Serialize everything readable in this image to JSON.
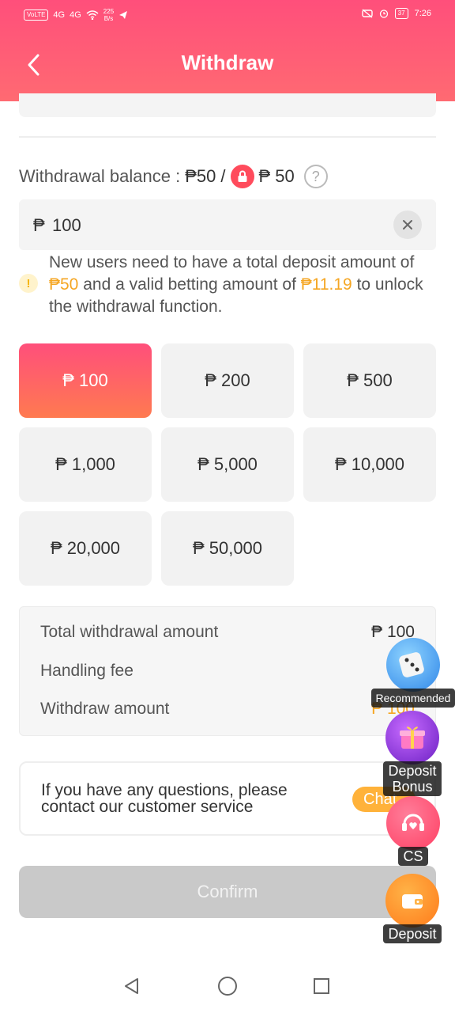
{
  "status_bar": {
    "left_chip": "VoLTE",
    "left_signal_1": "4G",
    "left_signal_2": "4G",
    "speed": "225",
    "speed_unit": "B/s",
    "time": "7:26",
    "battery": "37"
  },
  "header": {
    "title": "Withdraw"
  },
  "balance": {
    "label": "Withdrawal balance : ",
    "available": "₱50",
    "separator": " / ",
    "locked": "₱ 50"
  },
  "amount_input": {
    "currency": "₱",
    "value": "100"
  },
  "notice": {
    "part1": "New users need to have a total deposit amount of ",
    "deposit_amount": "₱50",
    "part2": " and a valid betting amount of ",
    "betting_amount": "₱11.19",
    "part3": " to unlock the withdrawal function."
  },
  "amount_options": [
    "₱ 100",
    "₱ 200",
    "₱ 500",
    "₱ 1,000",
    "₱ 5,000",
    "₱ 10,000",
    "₱ 20,000",
    "₱ 50,000"
  ],
  "selected_option": "₱ 100",
  "summary": {
    "total_label": "Total withdrawal amount",
    "total_value": "₱ 100",
    "fee_label": "Handling fee",
    "withdraw_label": "Withdraw amount",
    "withdraw_value": "₱ 100"
  },
  "help": {
    "text": "If you have any questions, please contact our customer service",
    "chat_label": "Chat"
  },
  "confirm_label": "Confirm",
  "floating": {
    "recommended": "Recommended",
    "deposit_bonus_1": "Deposit",
    "deposit_bonus_2": "Bonus",
    "cs": "CS",
    "deposit": "Deposit"
  },
  "colors": {
    "accent": "#ff4f7b",
    "highlight": "#f5a623",
    "chat": "#ffb23a"
  }
}
